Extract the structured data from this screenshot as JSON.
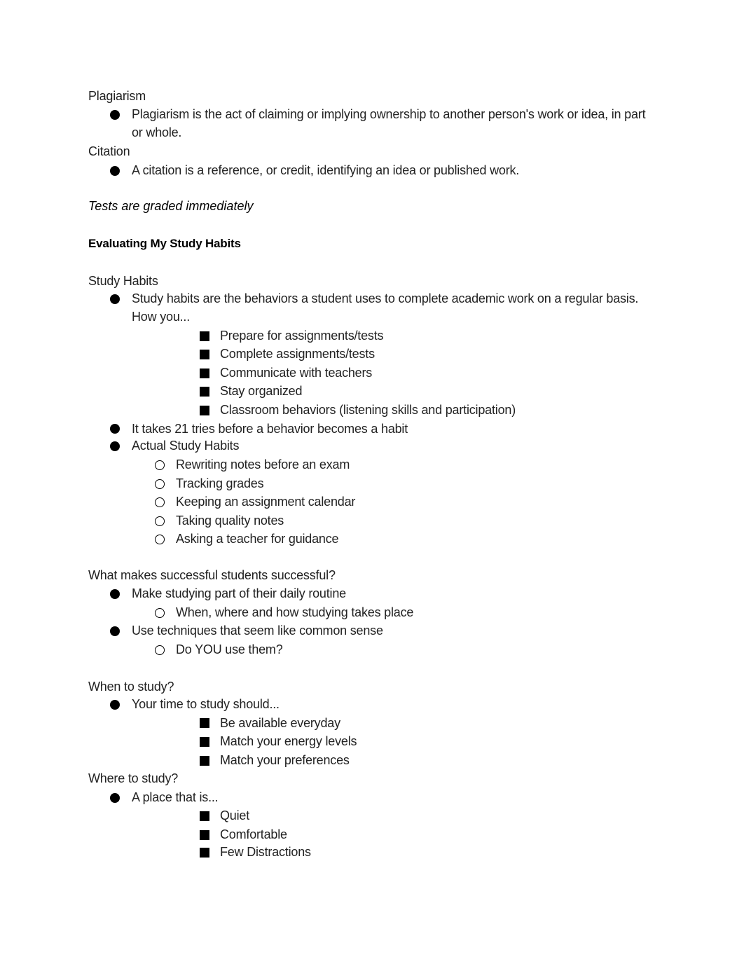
{
  "document": {
    "sections": {
      "plagiarism": {
        "heading": "Plagiarism",
        "bullets": [
          "Plagiarism is the act of claiming or implying ownership to another person's work or idea, in part or whole."
        ]
      },
      "citation": {
        "heading": "Citation",
        "bullets": [
          "A citation is a reference, or credit, identifying an idea or published work."
        ]
      },
      "note": "Tests are graded immediately",
      "title": "Evaluating My Study Habits",
      "study_habits": {
        "heading": "Study Habits",
        "bullet1": "Study habits are the behaviors a student uses to complete academic work on a regular basis. How you...",
        "bullet1_sub": [
          "Prepare for assignments/tests",
          "Complete assignments/tests",
          "Communicate with teachers",
          "Stay organized",
          "Classroom behaviors (listening skills and participation)"
        ],
        "bullet2": "It takes 21 tries before a behavior becomes a habit",
        "bullet3": "Actual Study Habits",
        "bullet3_sub": [
          "Rewriting notes before an exam",
          "Tracking grades",
          "Keeping an assignment calendar",
          "Taking quality notes",
          "Asking a teacher for guidance"
        ]
      },
      "successful": {
        "heading": "What makes successful students successful?",
        "bullet1": "Make studying part of their daily routine",
        "bullet1_sub": [
          "When, where and how studying takes place"
        ],
        "bullet2": "Use techniques that seem like common sense",
        "bullet2_sub": [
          "Do YOU use them?"
        ]
      },
      "when": {
        "heading": "When to study?",
        "bullet1": "Your time to study should...",
        "bullet1_sub": [
          "Be available everyday",
          "Match your energy levels",
          "Match your preferences"
        ]
      },
      "where": {
        "heading": "Where to study?",
        "bullet1": "A place that is...",
        "bullet1_sub": [
          "Quiet",
          "Comfortable",
          "Few Distractions"
        ]
      }
    }
  }
}
